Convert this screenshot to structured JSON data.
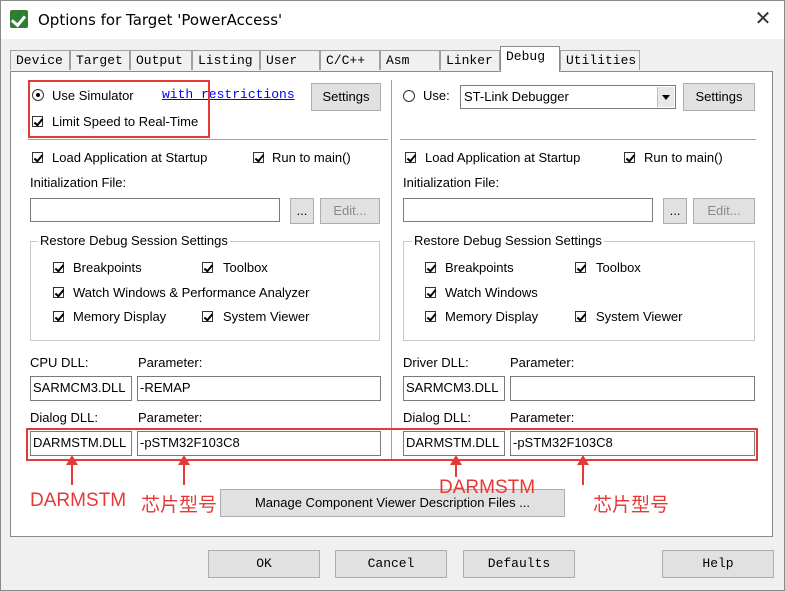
{
  "window": {
    "title": "Options for Target 'PowerAccess'",
    "close": "✕"
  },
  "tabs": [
    "Device",
    "Target",
    "Output",
    "Listing",
    "User",
    "C/C++",
    "Asm",
    "Linker",
    "Debug",
    "Utilities"
  ],
  "active_tab": "Debug",
  "left": {
    "use_simulator": "Use Simulator",
    "restrictions_link": "with restrictions",
    "settings": "Settings",
    "limit_speed": "Limit Speed to Real-Time",
    "load_app": "Load Application at Startup",
    "run_to_main": "Run to main()",
    "init_file_label": "Initialization File:",
    "browse": "...",
    "edit": "Edit...",
    "restore_group": "Restore Debug Session Settings",
    "breakpoints": "Breakpoints",
    "toolbox": "Toolbox",
    "watch_windows": "Watch Windows & Performance Analyzer",
    "memory_display": "Memory Display",
    "system_viewer": "System Viewer",
    "cpu_dll_label": "CPU DLL:",
    "parameter_label": "Parameter:",
    "cpu_dll": "SARMCM3.DLL",
    "cpu_param": "-REMAP",
    "dialog_dll_label": "Dialog DLL:",
    "dialog_dll": "DARMSTM.DLL",
    "dialog_param": "-pSTM32F103C8"
  },
  "right": {
    "use": "Use:",
    "debugger": "ST-Link Debugger",
    "settings": "Settings",
    "load_app": "Load Application at Startup",
    "run_to_main": "Run to main()",
    "init_file_label": "Initialization File:",
    "browse": "...",
    "edit": "Edit...",
    "restore_group": "Restore Debug Session Settings",
    "breakpoints": "Breakpoints",
    "toolbox": "Toolbox",
    "watch_windows": "Watch Windows",
    "memory_display": "Memory Display",
    "system_viewer": "System Viewer",
    "driver_dll_label": "Driver DLL:",
    "parameter_label": "Parameter:",
    "driver_dll": "SARMCM3.DLL",
    "driver_param": "",
    "dialog_dll_label": "Dialog DLL:",
    "dialog_dll": "DARMSTM.DLL",
    "dialog_param": "-pSTM32F103C8"
  },
  "manage_button": "Manage Component Viewer Description Files ...",
  "annotations": {
    "left_dll": "DARMSTM",
    "left_chip": "芯片型号",
    "right_dll": "DARMSTM",
    "right_chip": "芯片型号",
    "color": "#e53935"
  },
  "footer": {
    "ok": "OK",
    "cancel": "Cancel",
    "defaults": "Defaults",
    "help": "Help"
  }
}
